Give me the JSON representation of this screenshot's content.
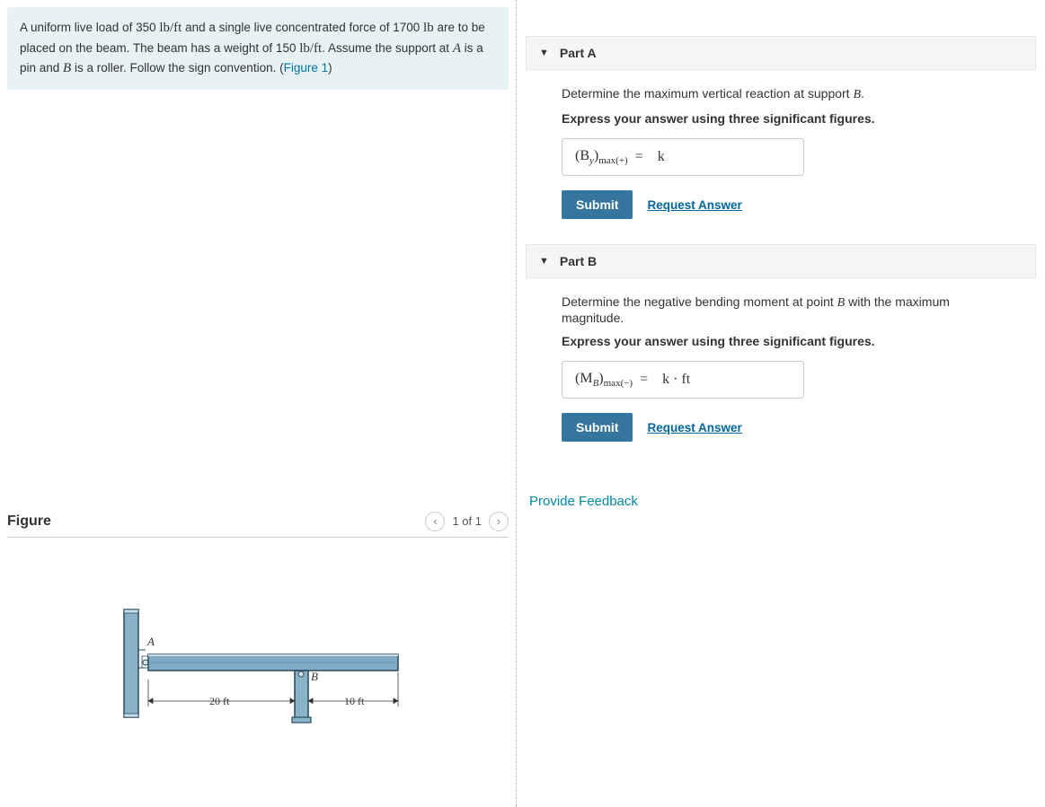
{
  "problem": {
    "text_pre": "A uniform live load of 350 ",
    "unit1": "lb/ft",
    "text_mid1": " and a single live concentrated force of 1700 ",
    "unit2": "lb",
    "text_mid2": " are to be placed on the beam. The beam has a weight of 150 ",
    "unit3": "lb/ft",
    "text_mid3": ". Assume the support at ",
    "varA": "A",
    "text_mid4": " is a pin and ",
    "varB": "B",
    "text_mid5": " is a roller. Follow the sign convention. (",
    "figlink": "Figure 1",
    "text_end": ")"
  },
  "figure": {
    "title": "Figure",
    "counter": "1 of 1",
    "labelA": "A",
    "labelB": "B",
    "dim1": "20 ft",
    "dim2": "10 ft"
  },
  "partA": {
    "title": "Part A",
    "question_pre": "Determine the maximum vertical reaction at support ",
    "var": "B",
    "question_post": ".",
    "instruction": "Express your answer using three significant figures.",
    "lhs_main": "(B",
    "lhs_sub1": "y",
    "lhs_close": ")",
    "lhs_sub2": "max(+)",
    "eq": "=",
    "unit": "k",
    "submit": "Submit",
    "request": "Request Answer"
  },
  "partB": {
    "title": "Part B",
    "question_pre": "Determine the negative bending moment at point ",
    "var": "B",
    "question_post": " with the maximum magnitude.",
    "instruction": "Express your answer using three significant figures.",
    "lhs_main": "(M",
    "lhs_sub1": "B",
    "lhs_close": ")",
    "lhs_sub2": "max(−)",
    "eq": "=",
    "unit": "k · ft",
    "submit": "Submit",
    "request": "Request Answer"
  },
  "feedback": "Provide Feedback"
}
